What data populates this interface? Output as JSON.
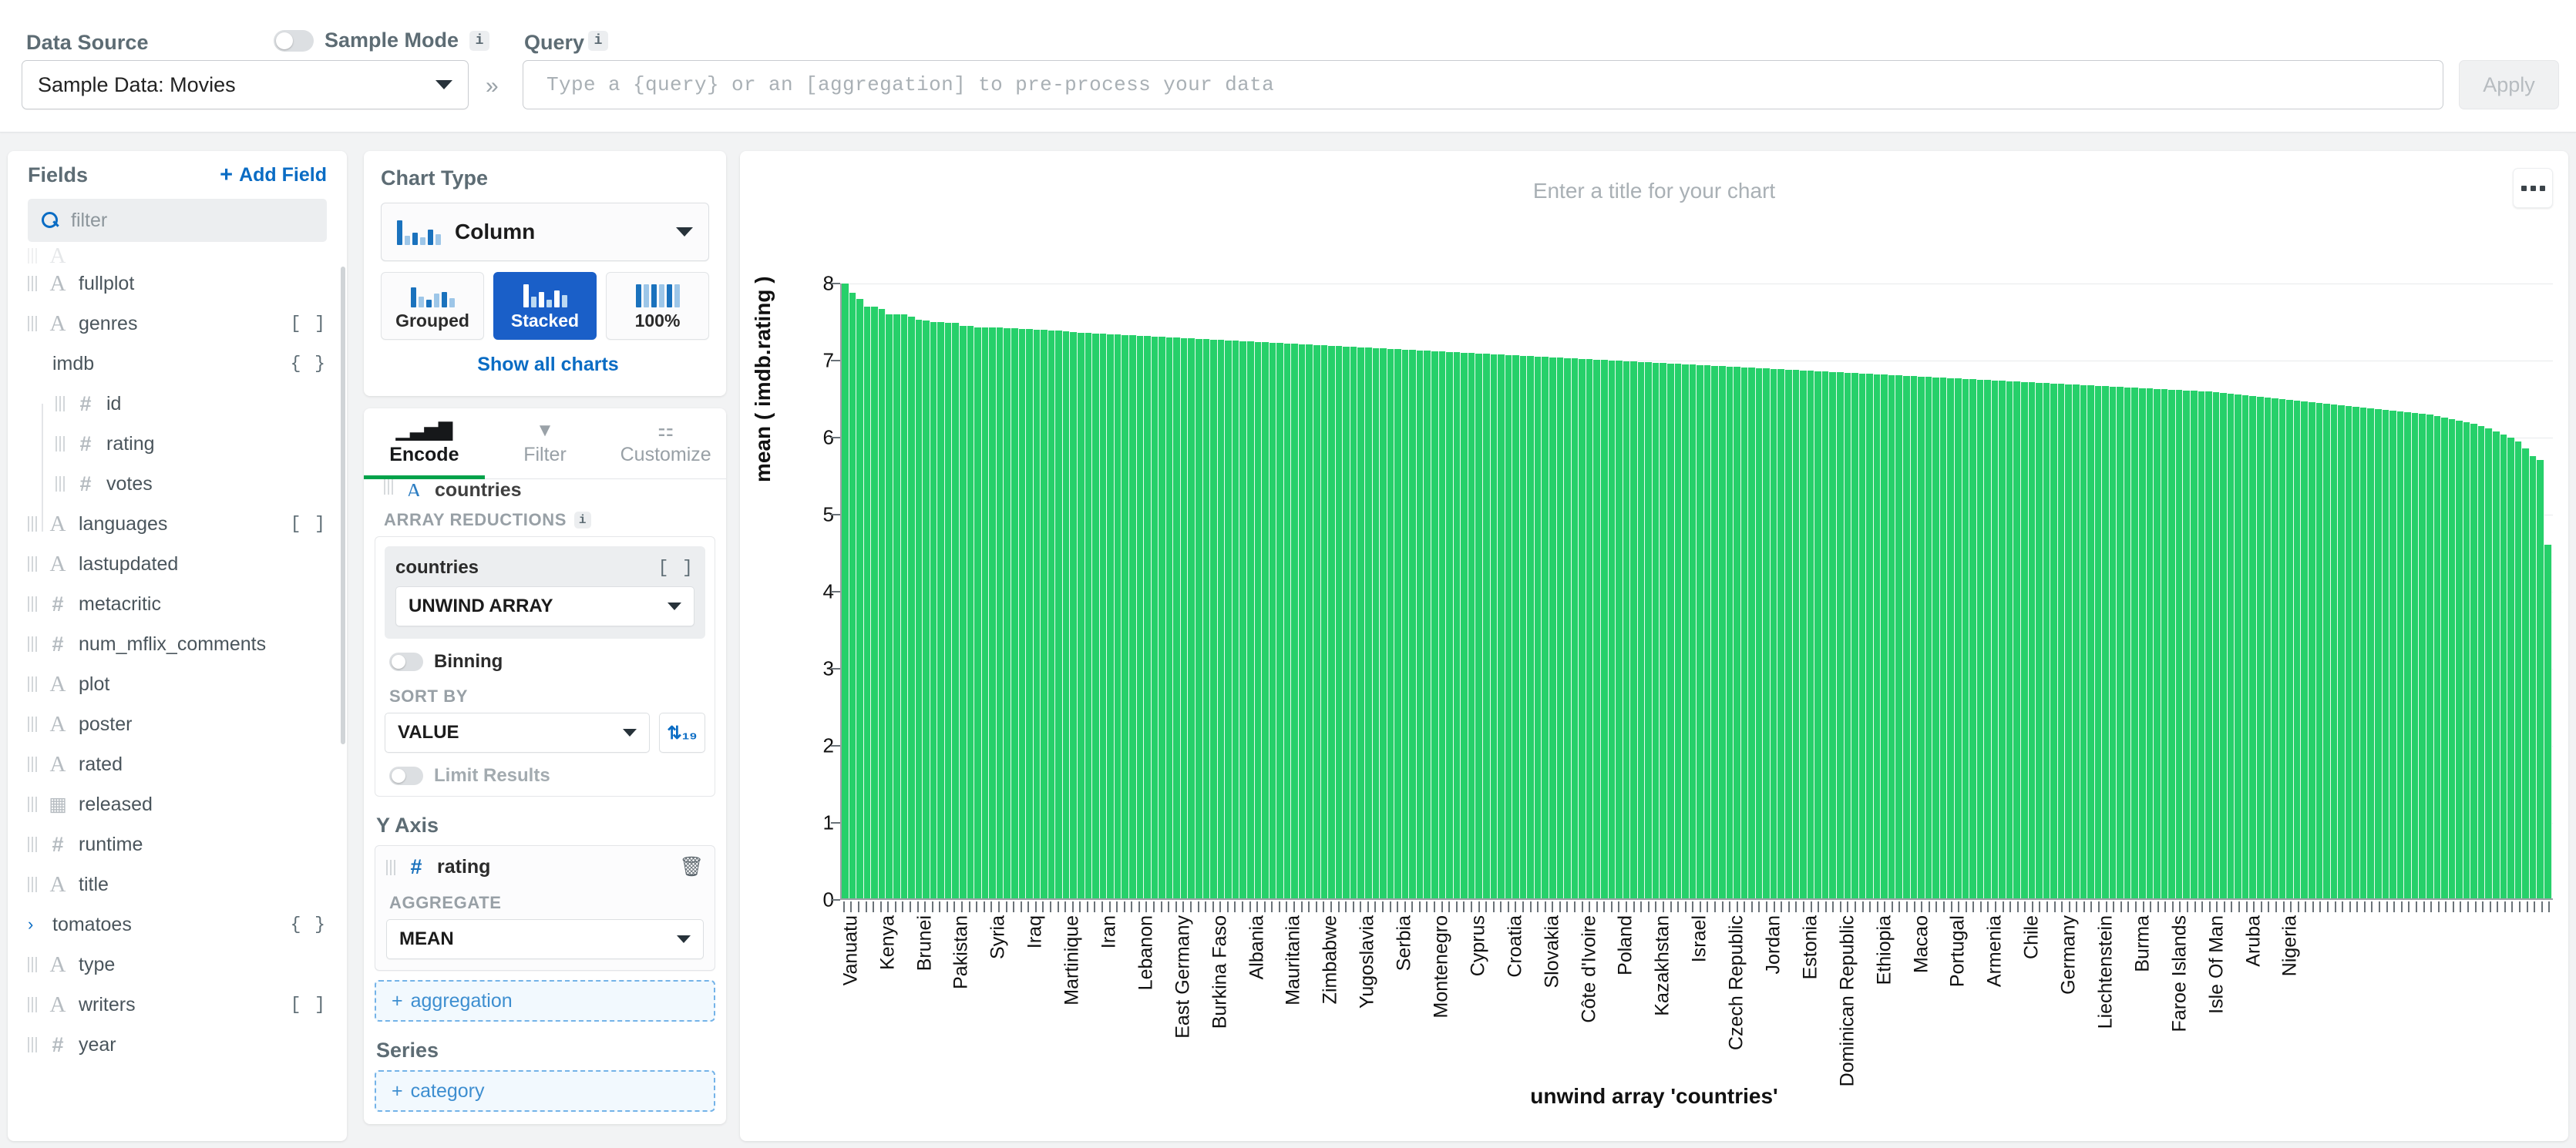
{
  "topbar": {
    "data_source_label": "Data Source",
    "sample_mode_label": "Sample Mode",
    "info_glyph": "i",
    "data_source_value": "Sample Data: Movies",
    "expand_glyph": "»",
    "query_label": "Query",
    "query_value": "",
    "query_placeholder": "Type a {query} or an [aggregation] to pre-process your data",
    "apply_label": "Apply"
  },
  "fields": {
    "title": "Fields",
    "add_field_label": "Add Field",
    "plus_glyph": "+",
    "filter_placeholder": "filter",
    "items": [
      {
        "name": "",
        "type": "text",
        "badge": "",
        "indent": 0,
        "clipped": true
      },
      {
        "name": "fullplot",
        "type": "text",
        "badge": "",
        "indent": 0
      },
      {
        "name": "genres",
        "type": "text",
        "badge": "[ ]",
        "indent": 0
      },
      {
        "name": "imdb",
        "type": "object",
        "badge": "{ }",
        "indent": 0,
        "twisty": "ⱟ"
      },
      {
        "name": "id",
        "type": "number",
        "badge": "",
        "indent": 1
      },
      {
        "name": "rating",
        "type": "number",
        "badge": "",
        "indent": 1
      },
      {
        "name": "votes",
        "type": "number",
        "badge": "",
        "indent": 1
      },
      {
        "name": "languages",
        "type": "text",
        "badge": "[ ]",
        "indent": 0
      },
      {
        "name": "lastupdated",
        "type": "text",
        "badge": "",
        "indent": 0
      },
      {
        "name": "metacritic",
        "type": "number",
        "badge": "",
        "indent": 0
      },
      {
        "name": "num_mflix_comments",
        "type": "number",
        "badge": "",
        "indent": 0
      },
      {
        "name": "plot",
        "type": "text",
        "badge": "",
        "indent": 0
      },
      {
        "name": "poster",
        "type": "text",
        "badge": "",
        "indent": 0
      },
      {
        "name": "rated",
        "type": "text",
        "badge": "",
        "indent": 0
      },
      {
        "name": "released",
        "type": "date",
        "badge": "",
        "indent": 0
      },
      {
        "name": "runtime",
        "type": "number",
        "badge": "",
        "indent": 0
      },
      {
        "name": "title",
        "type": "text",
        "badge": "",
        "indent": 0
      },
      {
        "name": "tomatoes",
        "type": "object",
        "badge": "{ }",
        "indent": 0,
        "twisty": "›"
      },
      {
        "name": "type",
        "type": "text",
        "badge": "",
        "indent": 0
      },
      {
        "name": "writers",
        "type": "text",
        "badge": "[ ]",
        "indent": 0
      },
      {
        "name": "year",
        "type": "number",
        "badge": "",
        "indent": 0
      }
    ]
  },
  "chart_type": {
    "title": "Chart Type",
    "selected": "Column",
    "variants": [
      {
        "label": "Grouped",
        "active": false
      },
      {
        "label": "Stacked",
        "active": true
      },
      {
        "label": "100%",
        "active": false
      }
    ],
    "show_all_label": "Show all charts",
    "chevron_glyph": "ⱟ"
  },
  "encode": {
    "tabs": [
      {
        "label": "Encode",
        "active": true
      },
      {
        "label": "Filter",
        "active": false
      },
      {
        "label": "Customize",
        "active": false
      }
    ],
    "x_field": {
      "name": "countries",
      "badge": ""
    },
    "array_reductions_label": "ARRAY REDUCTIONS",
    "reduction": {
      "field": "countries",
      "badge": "[ ]",
      "value": "UNWIND ARRAY"
    },
    "binning_label": "Binning",
    "sort_by_label": "SORT BY",
    "sort_by_value": "VALUE",
    "sort_dir_glyph": "⇅₁₉",
    "limit_results_label": "Limit Results",
    "y_axis": {
      "title": "Y Axis",
      "field": "rating",
      "aggregate_label": "AGGREGATE",
      "aggregate_value": "MEAN",
      "trash_glyph": "🗑"
    },
    "add_aggregation_label": "aggregation",
    "series_title": "Series",
    "add_category_label": "category",
    "plus_glyph": "+"
  },
  "chart_panel": {
    "title_placeholder": "Enter a title for your chart",
    "menu_glyph": "..."
  },
  "chart_data": {
    "type": "bar",
    "title": "",
    "xlabel": "unwind array 'countries'",
    "ylabel": "mean ( imdb.rating )",
    "ylim": [
      0,
      8
    ],
    "yticks": [
      0,
      1,
      2,
      3,
      4,
      5,
      6,
      7,
      8
    ],
    "grid": true,
    "bar_color": "#26d06a",
    "legend": "none",
    "tick_label_interval": 5,
    "categories": [
      "Vanuatu",
      "",
      "",
      "",
      "",
      "Kenya",
      "",
      "",
      "",
      "",
      "Brunei",
      "",
      "",
      "",
      "",
      "Pakistan",
      "",
      "",
      "",
      "",
      "Syria",
      "",
      "",
      "",
      "",
      "Iraq",
      "",
      "",
      "",
      "",
      "Martinique",
      "",
      "",
      "",
      "",
      "Iran",
      "",
      "",
      "",
      "",
      "Lebanon",
      "",
      "",
      "",
      "",
      "East Germany",
      "",
      "",
      "",
      "",
      "Burkina Faso",
      "",
      "",
      "",
      "",
      "Albania",
      "",
      "",
      "",
      "",
      "Mauritania",
      "",
      "",
      "",
      "",
      "Zimbabwe",
      "",
      "",
      "",
      "",
      "Yugoslavia",
      "",
      "",
      "",
      "",
      "Serbia",
      "",
      "",
      "",
      "",
      "Montenegro",
      "",
      "",
      "",
      "",
      "Cyprus",
      "",
      "",
      "",
      "",
      "Croatia",
      "",
      "",
      "",
      "",
      "Slovakia",
      "",
      "",
      "",
      "",
      "Côte d'Ivoire",
      "",
      "",
      "",
      "",
      "Poland",
      "",
      "",
      "",
      "",
      "Kazakhstan",
      "",
      "",
      "",
      "",
      "Israel",
      "",
      "",
      "",
      "",
      "Czech Republic",
      "",
      "",
      "",
      "",
      "Jordan",
      "",
      "",
      "",
      "",
      "Estonia",
      "",
      "",
      "",
      "",
      "Dominican Republic",
      "",
      "",
      "",
      "",
      "Ethiopia",
      "",
      "",
      "",
      "",
      "Macao",
      "",
      "",
      "",
      "",
      "Portugal",
      "",
      "",
      "",
      "",
      "Armenia",
      "",
      "",
      "",
      "",
      "Chile",
      "",
      "",
      "",
      "",
      "Germany",
      "",
      "",
      "",
      "",
      "Liechtenstein",
      "",
      "",
      "",
      "",
      "Burma",
      "",
      "",
      "",
      "",
      "Faroe Islands",
      "",
      "",
      "",
      "",
      "Isle Of Man",
      "",
      "",
      "",
      "",
      "Aruba",
      "",
      "",
      "",
      "",
      "Nigeria"
    ],
    "values": [
      8.0,
      7.88,
      7.8,
      7.7,
      7.7,
      7.67,
      7.6,
      7.6,
      7.6,
      7.57,
      7.53,
      7.52,
      7.5,
      7.5,
      7.49,
      7.49,
      7.45,
      7.45,
      7.43,
      7.43,
      7.43,
      7.43,
      7.42,
      7.42,
      7.41,
      7.41,
      7.4,
      7.4,
      7.39,
      7.39,
      7.38,
      7.37,
      7.36,
      7.36,
      7.35,
      7.35,
      7.34,
      7.34,
      7.33,
      7.33,
      7.32,
      7.32,
      7.31,
      7.31,
      7.3,
      7.3,
      7.29,
      7.29,
      7.28,
      7.28,
      7.27,
      7.27,
      7.26,
      7.26,
      7.25,
      7.25,
      7.24,
      7.24,
      7.23,
      7.23,
      7.22,
      7.22,
      7.21,
      7.21,
      7.2,
      7.2,
      7.19,
      7.19,
      7.18,
      7.18,
      7.17,
      7.17,
      7.16,
      7.16,
      7.15,
      7.15,
      7.14,
      7.14,
      7.13,
      7.13,
      7.12,
      7.12,
      7.11,
      7.11,
      7.1,
      7.1,
      7.09,
      7.09,
      7.08,
      7.08,
      7.07,
      7.07,
      7.06,
      7.06,
      7.05,
      7.05,
      7.04,
      7.04,
      7.03,
      7.03,
      7.02,
      7.02,
      7.01,
      7.01,
      7.0,
      7.0,
      6.99,
      6.99,
      6.98,
      6.98,
      6.97,
      6.97,
      6.96,
      6.96,
      6.95,
      6.95,
      6.94,
      6.94,
      6.93,
      6.93,
      6.92,
      6.92,
      6.91,
      6.91,
      6.9,
      6.9,
      6.89,
      6.89,
      6.88,
      6.88,
      6.87,
      6.87,
      6.86,
      6.86,
      6.85,
      6.85,
      6.84,
      6.84,
      6.83,
      6.83,
      6.82,
      6.82,
      6.81,
      6.81,
      6.8,
      6.8,
      6.79,
      6.79,
      6.78,
      6.78,
      6.77,
      6.77,
      6.76,
      6.76,
      6.75,
      6.75,
      6.74,
      6.74,
      6.73,
      6.73,
      6.72,
      6.72,
      6.71,
      6.71,
      6.7,
      6.7,
      6.69,
      6.69,
      6.68,
      6.68,
      6.67,
      6.67,
      6.66,
      6.66,
      6.65,
      6.65,
      6.64,
      6.64,
      6.63,
      6.63,
      6.62,
      6.62,
      6.61,
      6.61,
      6.6,
      6.6,
      6.59,
      6.58,
      6.57,
      6.56,
      6.55,
      6.54,
      6.53,
      6.52,
      6.51,
      6.5,
      6.49,
      6.48,
      6.47,
      6.46,
      6.45,
      6.44,
      6.43,
      6.42,
      6.41,
      6.4,
      6.39,
      6.38,
      6.37,
      6.36,
      6.35,
      6.34,
      6.33,
      6.32,
      6.31,
      6.3,
      6.28,
      6.26,
      6.24,
      6.22,
      6.2,
      6.18,
      6.15,
      6.12,
      6.08,
      6.04,
      6.0,
      5.95,
      5.85,
      5.75,
      5.7,
      4.6
    ]
  }
}
